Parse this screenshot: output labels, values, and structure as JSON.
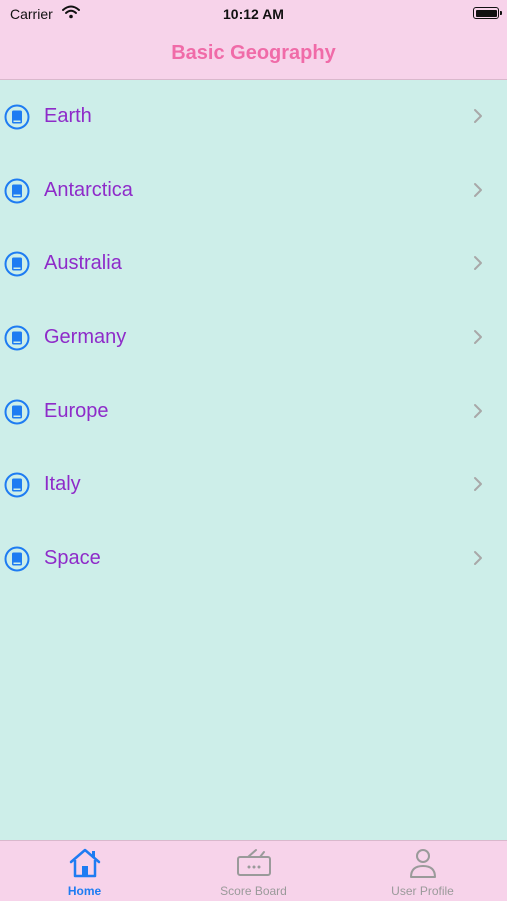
{
  "status": {
    "carrier": "Carrier",
    "time": "10:12 AM"
  },
  "nav": {
    "title": "Basic Geography"
  },
  "list": {
    "items": [
      {
        "label": "Earth",
        "icon": "book-icon"
      },
      {
        "label": "Antarctica",
        "icon": "book-icon"
      },
      {
        "label": "Australia",
        "icon": "book-icon"
      },
      {
        "label": "Germany",
        "icon": "book-icon"
      },
      {
        "label": "Europe",
        "icon": "book-icon"
      },
      {
        "label": "Italy",
        "icon": "book-icon"
      },
      {
        "label": "Space",
        "icon": "book-icon"
      }
    ]
  },
  "tabbar": {
    "tabs": [
      {
        "label": "Home",
        "icon": "home-icon",
        "active": true
      },
      {
        "label": "Score Board",
        "icon": "scoreboard-icon",
        "active": false
      },
      {
        "label": "User Profile",
        "icon": "user-icon",
        "active": false
      }
    ]
  },
  "colors": {
    "header_bg": "#F7D3EA",
    "content_bg": "#CDEEE9",
    "title": "#F06BA8",
    "item_text": "#8E2BC9",
    "accent": "#1E7CF2",
    "inactive": "#9A9A9A"
  }
}
